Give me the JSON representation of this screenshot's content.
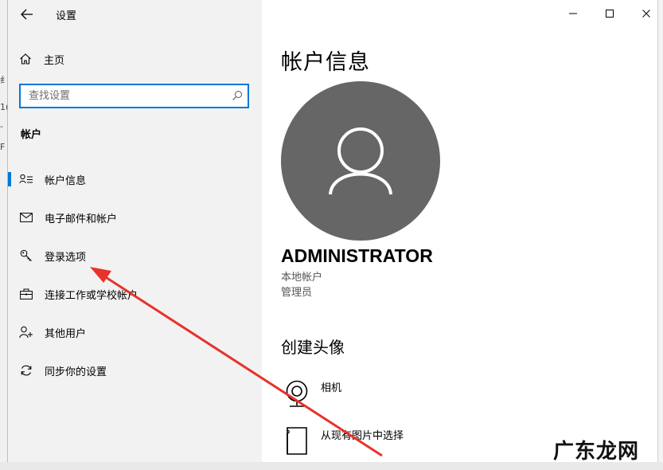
{
  "window": {
    "title": "设置"
  },
  "sidebar": {
    "home_label": "主页",
    "search_placeholder": "查找设置",
    "section_title": "帐户",
    "items": [
      {
        "label": "帐户信息",
        "icon": "account-info-icon",
        "selected": true
      },
      {
        "label": "电子邮件和帐户",
        "icon": "mail-icon",
        "selected": false
      },
      {
        "label": "登录选项",
        "icon": "key-icon",
        "selected": false
      },
      {
        "label": "连接工作或学校帐户",
        "icon": "briefcase-icon",
        "selected": false
      },
      {
        "label": "其他用户",
        "icon": "add-user-icon",
        "selected": false
      },
      {
        "label": "同步你的设置",
        "icon": "sync-icon",
        "selected": false
      }
    ]
  },
  "main": {
    "title": "帐户信息",
    "user": {
      "name": "ADMINISTRATOR",
      "account_type": "本地帐户",
      "role": "管理员"
    },
    "create_avatar": {
      "heading": "创建头像",
      "options": [
        {
          "label": "相机",
          "icon": "camera-icon"
        },
        {
          "label": "从现有图片中选择",
          "icon": "browse-icon"
        }
      ]
    }
  },
  "watermark": "广东龙网",
  "colors": {
    "accent": "#0078d7",
    "avatar_bg": "#666666",
    "annotation_arrow": "#e8322b"
  }
}
